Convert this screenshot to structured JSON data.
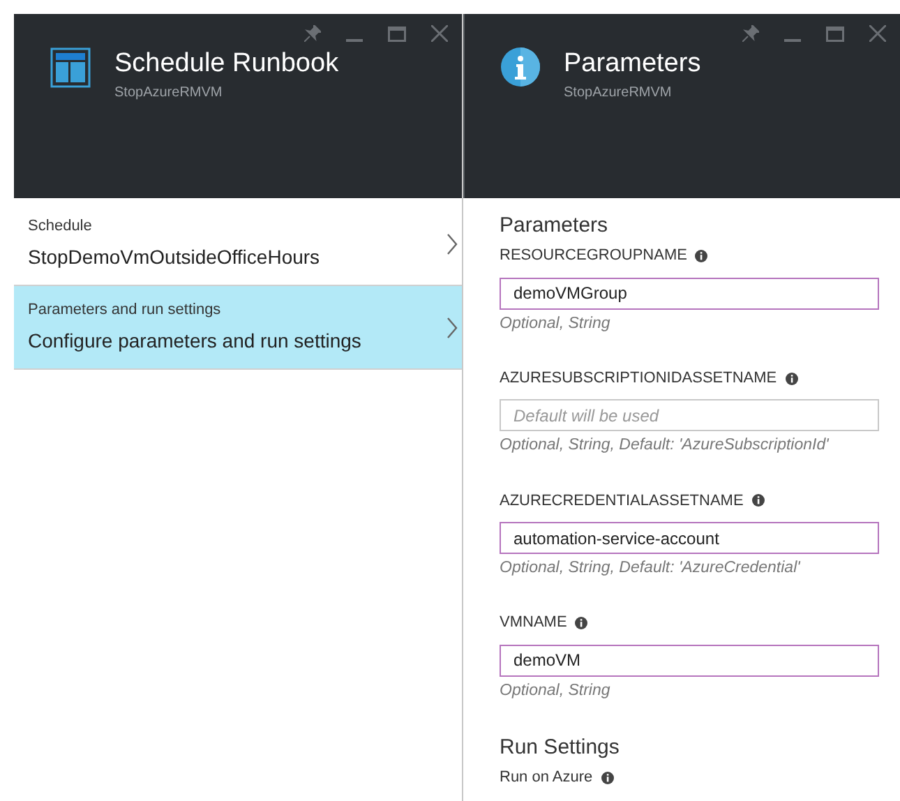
{
  "blades": [
    {
      "title": "Schedule Runbook",
      "subtitle": "StopAzureRMVM",
      "kind": "layout"
    },
    {
      "title": "Parameters",
      "subtitle": "StopAzureRMVM",
      "kind": "info"
    }
  ],
  "menu": [
    {
      "label": "Schedule",
      "value": "StopDemoVmOutsideOfficeHours",
      "selected": false
    },
    {
      "label": "Parameters and run settings",
      "value": "Configure parameters and run settings",
      "selected": true
    }
  ],
  "parameters": {
    "heading": "Parameters",
    "fields": [
      {
        "label": "RESOURCEGROUPNAME",
        "value": "demoVMGroup",
        "hint": "Optional, String"
      },
      {
        "label": "AZURESUBSCRIPTIONIDASSETNAME",
        "placeholder": "Default will be used",
        "hint": "Optional, String, Default: 'AzureSubscriptionId'"
      },
      {
        "label": "AZURECREDENTIALASSETNAME",
        "value": "automation-service-account",
        "hint": "Optional, String, Default: 'AzureCredential'"
      },
      {
        "label": "VMNAME",
        "value": "demoVM",
        "hint": "Optional, String"
      }
    ]
  },
  "run_settings": {
    "heading": "Run Settings",
    "label": "Run on Azure"
  }
}
